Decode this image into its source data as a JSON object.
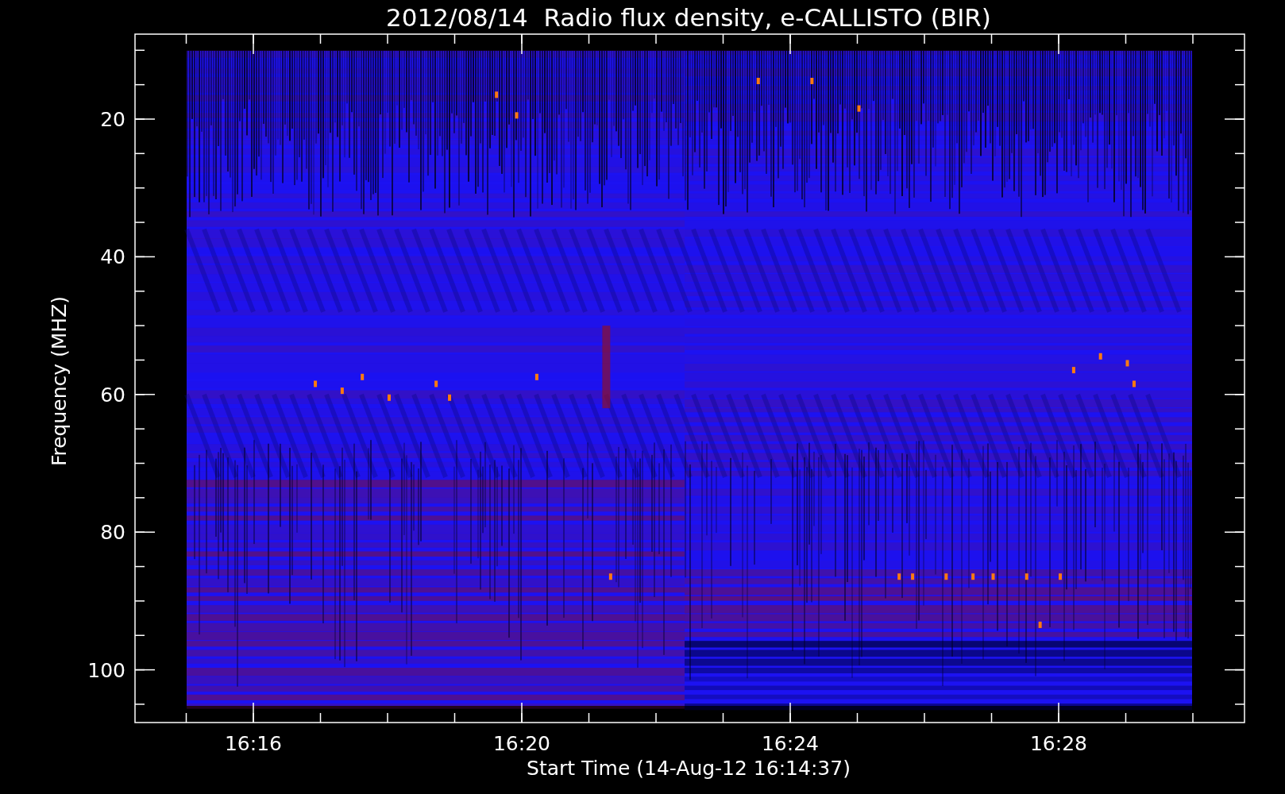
{
  "title": "2012/08/14  Radio flux density, e-CALLISTO (BIR)",
  "y_axis": {
    "label": "Frequency (MHZ)",
    "ticks": [
      "20",
      "40",
      "60",
      "80",
      "100"
    ]
  },
  "x_axis": {
    "label": "Start Time (14-Aug-12 16:14:37)",
    "ticks": [
      "16:16",
      "16:20",
      "16:24",
      "16:28"
    ]
  }
}
